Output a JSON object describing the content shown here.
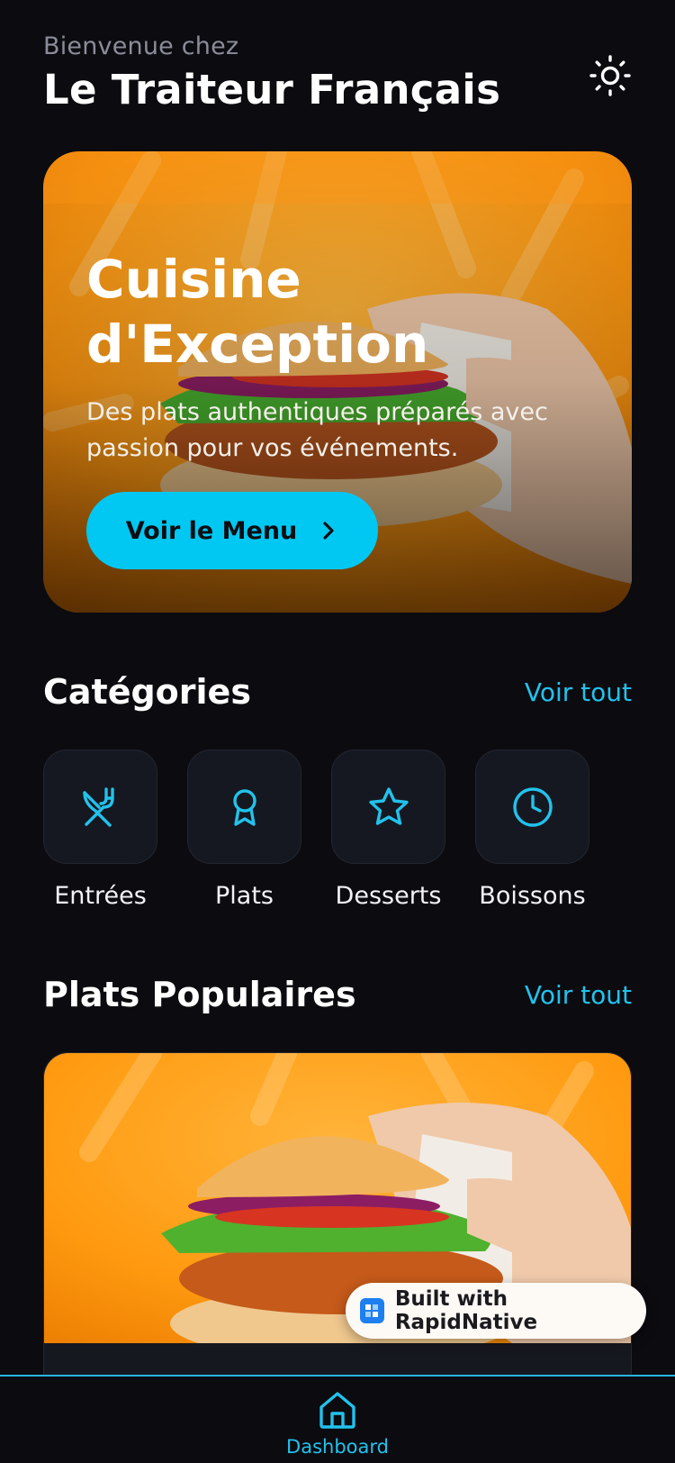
{
  "header": {
    "welcome": "Bienvenue chez",
    "brand": "Le Traiteur Français",
    "theme_icon": "sun-icon"
  },
  "hero": {
    "title_line1": "Cuisine",
    "title_line2": "d'Exception",
    "description_line1": "Des plats authentiques préparés avec",
    "description_line2": "passion pour vos événements.",
    "button_label": "Voir le Menu",
    "button_icon": "chevron-right-icon",
    "image": "burger-photo"
  },
  "categories": {
    "title": "Catégories",
    "link": "Voir tout",
    "items": [
      {
        "label": "Entrées",
        "icon": "utensils-crossed-icon"
      },
      {
        "label": "Plats",
        "icon": "award-icon"
      },
      {
        "label": "Desserts",
        "icon": "star-icon"
      },
      {
        "label": "Boissons",
        "icon": "clock-icon"
      }
    ]
  },
  "popular": {
    "title": "Plats Populaires",
    "link": "Voir tout",
    "image": "burger-photo"
  },
  "badge": {
    "label": "Built with RapidNative"
  },
  "tabbar": {
    "items": [
      {
        "label": "Dashboard",
        "icon": "home-icon",
        "active": true
      }
    ]
  },
  "colors": {
    "background": "#0b0b10",
    "accent": "#00c8f2",
    "card": "#151820",
    "muted_text": "#8a8d99",
    "hero_orange": "#ff9a0e"
  }
}
